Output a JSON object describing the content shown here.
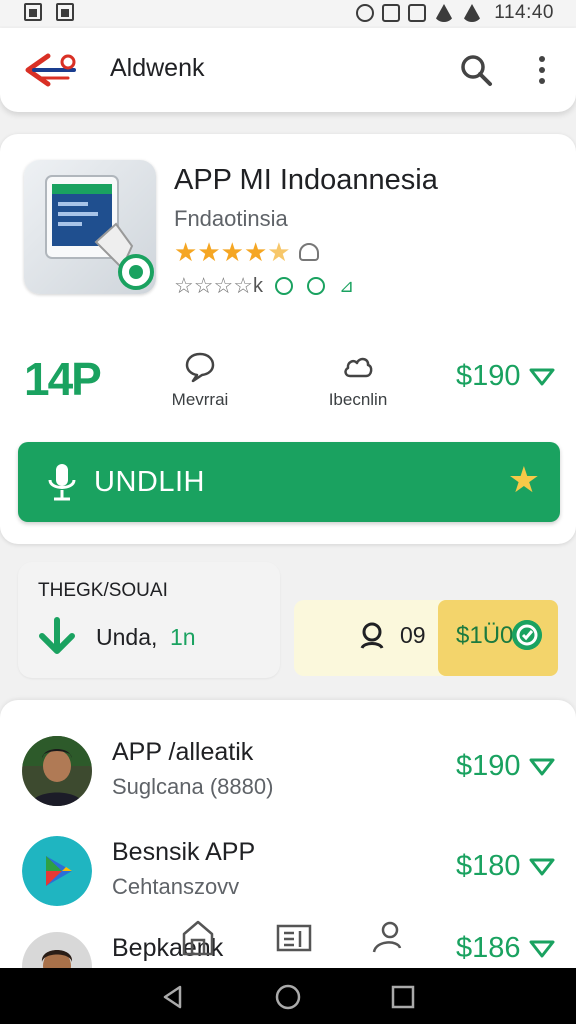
{
  "status_bar": {
    "time": "114:40"
  },
  "app_bar": {
    "title": "Aldwenk",
    "icons": [
      "app-logo",
      "search-icon",
      "more-vert-icon"
    ]
  },
  "app_card": {
    "title": "APP MI Indoannesia",
    "developer": "Fndaotinsia",
    "rating_stars": 4.5,
    "rating_extra": "k",
    "stats": {
      "rating_value": "14P",
      "reviews_label": "Mevrrai",
      "downloads_label": "Ibecnlin",
      "price": "$190"
    },
    "install_label": "UNDLIH"
  },
  "info_card": {
    "heading": "THEGK/SOUAI",
    "text": "Unda,",
    "sub": "1n"
  },
  "compare_card": {
    "count": "09",
    "price": "$1Ü0"
  },
  "list": [
    {
      "title": "APP /alleatik",
      "subtitle": "Suglcana (8880)",
      "price": "$190"
    },
    {
      "title": "Besnsik APP",
      "subtitle": "Cehtanszovv",
      "price": "$180"
    },
    {
      "title": "Bepkaenk",
      "subtitle": "",
      "price": "$186"
    }
  ],
  "colors": {
    "accent": "#1aa260",
    "star": "#f5a623",
    "highlight": "#f3d46b"
  }
}
